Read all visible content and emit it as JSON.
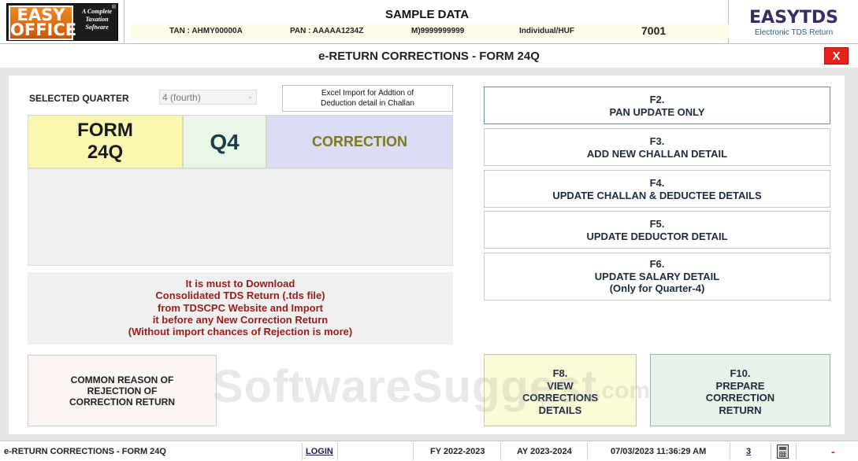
{
  "header": {
    "logo_text_top": "EASY",
    "logo_text_bottom": "OFFICE",
    "logo_tagline": "A Complete Taxation Software",
    "logo_reg": "®",
    "title": "SAMPLE DATA",
    "tan": "TAN : AHMY00000A",
    "pan": "PAN : AAAAA1234Z",
    "mobile": "M)9999999999",
    "status": "Individual/HUF",
    "code": "7001",
    "brand": "EASYTDS",
    "brand_sub": "Electronic TDS Return"
  },
  "window": {
    "title": "e-RETURN CORRECTIONS - FORM 24Q",
    "close_label": "X"
  },
  "quarter": {
    "label": "SELECTED QUARTER",
    "value": "4 (fourth)"
  },
  "excel_button": {
    "line1": "Excel Import for Addtion of",
    "line2": "Deduction detail in Challan"
  },
  "info": {
    "form_line1": "FORM",
    "form_line2": "24Q",
    "quarter": "Q4",
    "type": "CORRECTION"
  },
  "message": {
    "line1": "It is must to Download",
    "line2": "Consolidated TDS Return (.tds file)",
    "line3": "from TDSCPC Website and Import",
    "line4": "it before any New Correction Return",
    "line5": "(Without import chances of Rejection is more)"
  },
  "reason_button": {
    "line1": "COMMON REASON OF",
    "line2": "REJECTION OF",
    "line3": "CORRECTION RETURN"
  },
  "actions": [
    {
      "key": "F2.",
      "label": "PAN UPDATE ONLY",
      "extra": ""
    },
    {
      "key": "F3.",
      "label": "ADD NEW CHALLAN DETAIL",
      "extra": ""
    },
    {
      "key": "F4.",
      "label": "UPDATE CHALLAN & DEDUCTEE DETAILS",
      "extra": ""
    },
    {
      "key": "F5.",
      "label": "UPDATE DEDUCTOR DETAIL",
      "extra": ""
    },
    {
      "key": "F6.",
      "label": "UPDATE SALARY DETAIL",
      "extra": "(Only for Quarter-4)"
    }
  ],
  "view_button": {
    "key": "F8.",
    "line1": "VIEW",
    "line2": "CORRECTIONS",
    "line3": "DETAILS"
  },
  "prepare_button": {
    "key": "F10.",
    "line1": "PREPARE",
    "line2": "CORRECTION",
    "line3": "RETURN"
  },
  "watermark": {
    "text": "SoftwareSuggest",
    "suffix": ".com"
  },
  "statusbar": {
    "screen": "e-RETURN CORRECTIONS - FORM 24Q",
    "login": "LOGIN",
    "fy": "FY 2022-2023",
    "ay": "AY 2023-2024",
    "datetime": "07/03/2023 11:36:29 AM",
    "count": "3",
    "minimize": "-"
  }
}
